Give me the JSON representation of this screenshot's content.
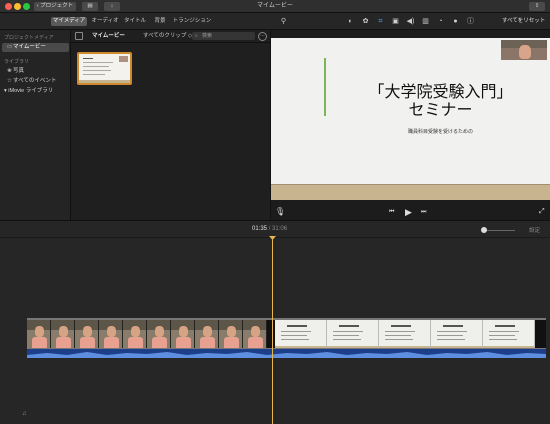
{
  "window": {
    "title": "マイムービー"
  },
  "titlebar": {
    "projects_label": "プロジェクト",
    "media_icon": "film-icon",
    "import_icon": "down-arrow-icon",
    "share_icon": "share-icon"
  },
  "tabs": [
    {
      "label": "マイメディア",
      "active": true
    },
    {
      "label": "オーディオ",
      "active": false
    },
    {
      "label": "タイトル",
      "active": false
    },
    {
      "label": "背景",
      "active": false
    },
    {
      "label": "トランジション",
      "active": false
    }
  ],
  "toolbar": {
    "tools": [
      "magic-wand-icon",
      "color-balance-icon",
      "color-correction-icon",
      "crop-icon",
      "stabilization-icon",
      "volume-icon",
      "noise-reduction-icon",
      "speed-icon",
      "clip-filter-icon",
      "info-icon"
    ],
    "reset_all": "すべてをリセット"
  },
  "sidebar": {
    "project_media_header": "プロジェクトメディア",
    "project_item": "マイムービー",
    "libraries_header": "ライブラリ",
    "items": [
      {
        "label": "写真"
      },
      {
        "label": "すべてのイベント"
      }
    ],
    "library_name": "iMovie ライブラリ"
  },
  "browser": {
    "title": "マイムービー",
    "filter": "すべてのクリップ ◇",
    "search_placeholder": "検索"
  },
  "viewer": {
    "slide_title_line1": "「大学院受験入門」",
    "slide_title_line2": "セミナー",
    "slide_subtitle": "職員科目受験を受けるための"
  },
  "timeline": {
    "current_time": "01:35",
    "total_time": "31:06",
    "settings_label": "設定"
  },
  "colors": {
    "accent_selection": "#d08a2c",
    "playhead": "#e6b84a",
    "audio_track": "#1d3f8a",
    "slide_accent": "#7ab55a"
  }
}
